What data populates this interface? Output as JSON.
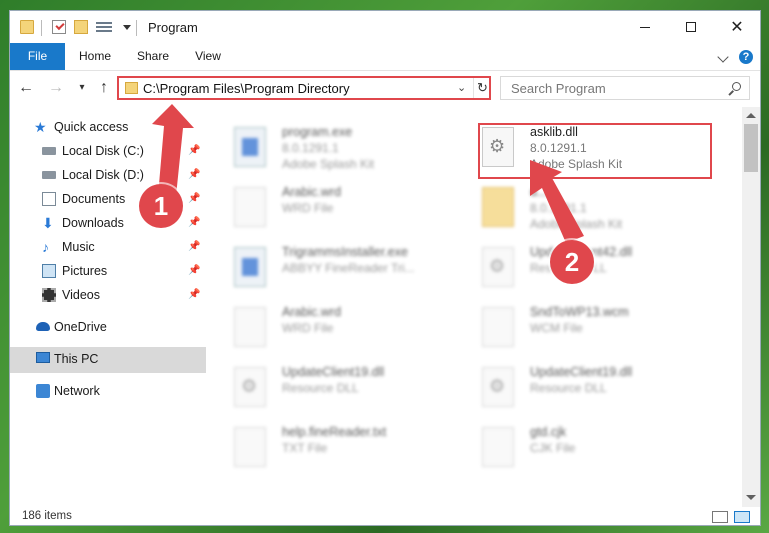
{
  "window": {
    "title": "Program"
  },
  "ribbon": {
    "tabs": [
      "File",
      "Home",
      "Share",
      "View"
    ]
  },
  "address": {
    "path": "C:\\Program Files\\Program Directory"
  },
  "search": {
    "placeholder": "Search Program"
  },
  "sidebar": {
    "items": [
      {
        "label": "Quick access",
        "icon": "star-icon",
        "pinned": false
      },
      {
        "label": "Local Disk (C:)",
        "icon": "drive-icon",
        "pinned": true
      },
      {
        "label": "Local Disk (D:)",
        "icon": "drive-icon",
        "pinned": true
      },
      {
        "label": "Documents",
        "icon": "documents-icon",
        "pinned": true
      },
      {
        "label": "Downloads",
        "icon": "download-icon",
        "pinned": true
      },
      {
        "label": "Music",
        "icon": "music-icon",
        "pinned": true
      },
      {
        "label": "Pictures",
        "icon": "pictures-icon",
        "pinned": true
      },
      {
        "label": "Videos",
        "icon": "videos-icon",
        "pinned": true
      },
      {
        "label": "OneDrive",
        "icon": "cloud-icon",
        "pinned": false
      },
      {
        "label": "This PC",
        "icon": "computer-icon",
        "pinned": false,
        "selected": true
      },
      {
        "label": "Network",
        "icon": "network-icon",
        "pinned": false
      }
    ]
  },
  "files": [
    {
      "name": "program.exe",
      "line2": "8.0.1291.1",
      "line3": "Adobe Splash Kit",
      "type": "exe",
      "blurred": true
    },
    {
      "name": "asklib.dll",
      "line2": "8.0.1291.1",
      "line3": "Adobe Splash Kit",
      "type": "dll",
      "blurred": false
    },
    {
      "name": "Arabic.wrd",
      "line2": "WRD File",
      "line3": "",
      "type": "doc",
      "blurred": true
    },
    {
      "name": "d...",
      "line2": "8.0.1291.1",
      "line3": "Adobe Splash Kit",
      "type": "folder",
      "blurred": true
    },
    {
      "name": "TrigrammsInstaller.exe",
      "line2": "ABBYY FineReader Tri...",
      "line3": "",
      "type": "exe",
      "blurred": true
    },
    {
      "name": "UpdateClient42.dll",
      "line2": "Resource DLL",
      "line3": "",
      "type": "dll",
      "blurred": true
    },
    {
      "name": "Arabic.wrd",
      "line2": "WRD File",
      "line3": "",
      "type": "doc",
      "blurred": true
    },
    {
      "name": "SndToWP13.wcm",
      "line2": "WCM File",
      "line3": "",
      "type": "doc",
      "blurred": true
    },
    {
      "name": "UpdateClient19.dll",
      "line2": "Resource DLL",
      "line3": "",
      "type": "dll",
      "blurred": true
    },
    {
      "name": "UpdateClient19.dll",
      "line2": "Resource DLL",
      "line3": "",
      "type": "dll",
      "blurred": true
    },
    {
      "name": "help.fineReader.txt",
      "line2": "TXT File",
      "line3": "",
      "type": "doc",
      "blurred": true
    },
    {
      "name": "gtd.cjk",
      "line2": "CJK File",
      "line3": "",
      "type": "doc",
      "blurred": true
    }
  ],
  "status": {
    "item_count": "186 items"
  },
  "annotations": {
    "callout1": "1",
    "callout2": "2",
    "color": "#e0474c"
  },
  "colors": {
    "accent": "#1979ca",
    "highlight": "#e0474c"
  }
}
